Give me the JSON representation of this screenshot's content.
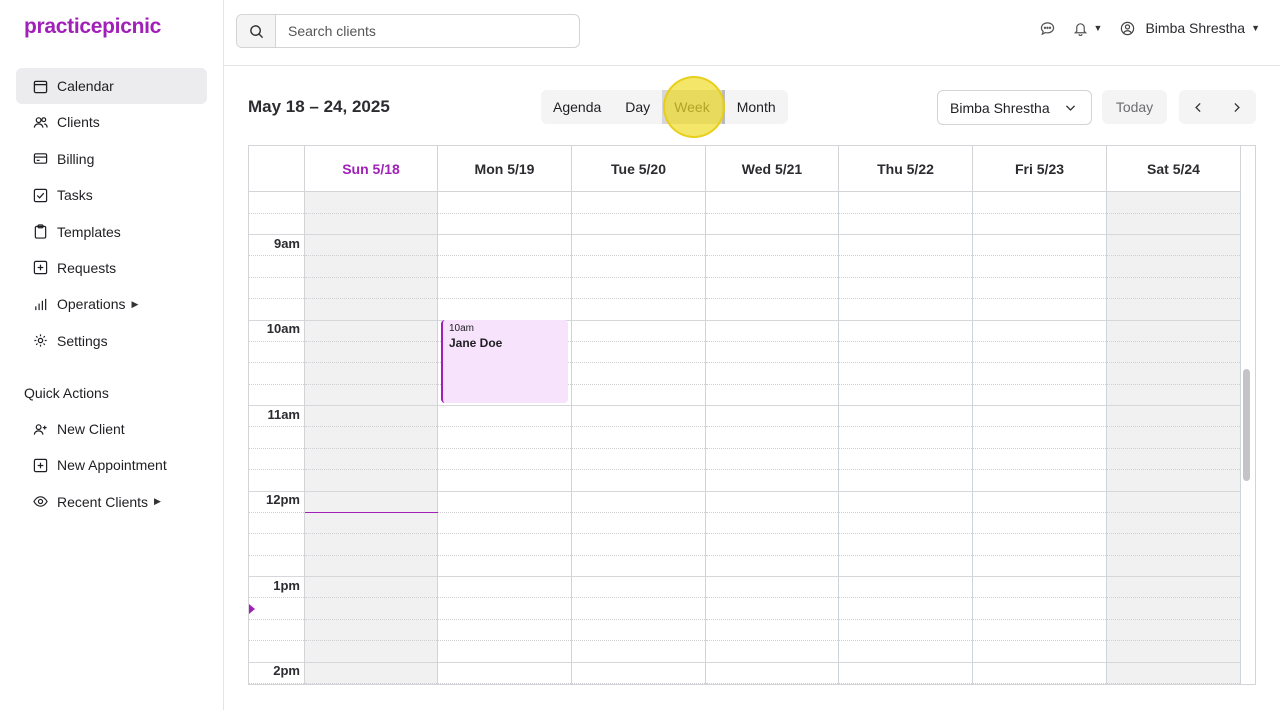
{
  "app": {
    "logo": "practicepicnic",
    "brand_color": "#a020b8"
  },
  "sidebar": {
    "items": [
      {
        "label": "Calendar",
        "icon": "calendar-icon",
        "active": true
      },
      {
        "label": "Clients",
        "icon": "users-icon"
      },
      {
        "label": "Billing",
        "icon": "credit-card-icon"
      },
      {
        "label": "Tasks",
        "icon": "checkbox-icon"
      },
      {
        "label": "Templates",
        "icon": "clipboard-icon"
      },
      {
        "label": "Requests",
        "icon": "plus-square-icon"
      },
      {
        "label": "Operations",
        "icon": "bar-chart-icon",
        "has_submenu": true
      },
      {
        "label": "Settings",
        "icon": "gear-icon"
      }
    ],
    "quick_actions_title": "Quick Actions",
    "quick_actions": [
      {
        "label": "New Client",
        "icon": "user-plus-icon"
      },
      {
        "label": "New Appointment",
        "icon": "plus-square-icon"
      },
      {
        "label": "Recent Clients",
        "icon": "eye-icon",
        "has_submenu": true
      }
    ]
  },
  "topbar": {
    "search": {
      "placeholder": "Search clients",
      "value": ""
    },
    "user_name": "Bimba Shrestha"
  },
  "calendar": {
    "range_title": "May 18 – 24, 2025",
    "views": [
      "Agenda",
      "Day",
      "Week",
      "Month"
    ],
    "active_view": "Week",
    "provider": "Bimba Shrestha",
    "today_label": "Today",
    "days": [
      {
        "label": "Sun 5/18",
        "today": true,
        "off": true
      },
      {
        "label": "Mon 5/19",
        "today": false,
        "off": false
      },
      {
        "label": "Tue 5/20",
        "today": false,
        "off": false
      },
      {
        "label": "Wed 5/21",
        "today": false,
        "off": false
      },
      {
        "label": "Thu 5/22",
        "today": false,
        "off": false
      },
      {
        "label": "Fri 5/23",
        "today": false,
        "off": false
      },
      {
        "label": "Sat 5/24",
        "today": false,
        "off": true
      }
    ],
    "hours": [
      "9am",
      "10am",
      "11am",
      "12pm",
      "1pm",
      "2pm"
    ],
    "events": [
      {
        "time": "10am",
        "title": "Jane Doe",
        "day": "Mon 5/19"
      }
    ]
  }
}
